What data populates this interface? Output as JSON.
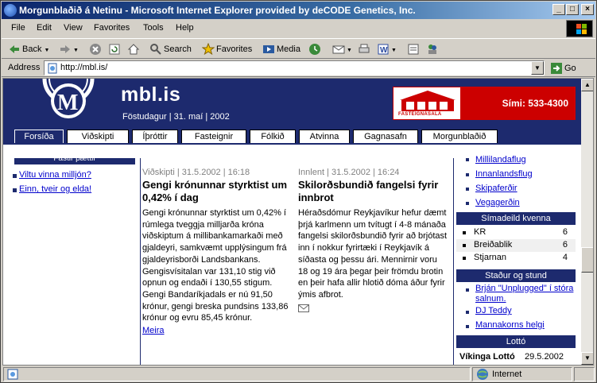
{
  "window": {
    "title": "Morgunblaðið á Netinu - Microsoft Internet Explorer provided by deCODE Genetics, Inc."
  },
  "menu": [
    "File",
    "Edit",
    "View",
    "Favorites",
    "Tools",
    "Help"
  ],
  "toolbar": {
    "back": "Back",
    "search": "Search",
    "favorites": "Favorites",
    "media": "Media"
  },
  "address": {
    "label": "Address",
    "url": "http://mbl.is/",
    "go": "Go"
  },
  "site": {
    "name": "mbl.is",
    "date": "Föstudagur | 31. maí | 2002",
    "ad_name": "FASTEIGNASALA",
    "ad_phone": "Sími: 533-4300",
    "colors": {
      "navy": "#1d2a6e",
      "ad_red": "#cc0000",
      "link": "#0000cc"
    }
  },
  "tabs": [
    "Forsíða",
    "Viðskipti",
    "Íþróttir",
    "Fasteignir",
    "Fólkið",
    "Atvinna",
    "Gagnasafn",
    "Morgunblaðið"
  ],
  "left": {
    "box_title": "Fastir þættir",
    "links": [
      "Viltu vinna milljón?",
      "Einn, tveir og elda!"
    ]
  },
  "news": [
    {
      "meta": "Viðskipti | 31.5.2002 | 16:18",
      "headline": "Gengi krónunnar styrktist um 0,42% í dag",
      "body": "Gengi krónunnar styrktist um 0,42% í rúmlega tveggja milljarða króna viðskiptum á millibankamarkaði með gjaldeyri, samkvæmt upplýsingum frá gjaldeyrisborði Landsbankans. Gengisvísitalan var 131,10 stig við opnun og endaði í 130,55 stigum. Gengi Bandaríkjadals er nú 91,50 krónur, gengi breska pundsins 133,86 krónur og evru 85,45 krónur.",
      "more": "Meira"
    },
    {
      "meta": "Innlent | 31.5.2002 | 16:24",
      "headline": "Skilorðsbundið fangelsi fyrir innbrot",
      "body": "Héraðsdómur Reykjavíkur hefur dæmt þrjá karlmenn um tvítugt í 4-8 mánaða fangelsi skilorðsbundið fyrir að brjótast inn í nokkur fyrirtæki í Reykjavík á síðasta og þessu ári. Mennirnir voru 18 og 19 ára þegar þeir frömdu brotin en þeir hafa allir hlotið dóma áður fyrir ýmis afbrot."
    }
  ],
  "right": {
    "links": [
      "Millilandaflug",
      "Innanlandsflug",
      "Skipaferðir",
      "Vegagerðin"
    ],
    "league": {
      "title": "Símadeild kvenna",
      "rows": [
        {
          "team": "KR",
          "pts": "6"
        },
        {
          "team": "Breiðablik",
          "pts": "6"
        },
        {
          "team": "Stjarnan",
          "pts": "4"
        }
      ]
    },
    "events": {
      "title": "Staður og stund",
      "links": [
        "Brján \"Unplugged\" í stóra salnum.",
        "DJ Teddy",
        "Mannakorns helgi"
      ]
    },
    "lotto": {
      "title": "Lottó",
      "name": "Víkinga Lottó",
      "date": "29.5.2002"
    }
  },
  "status": {
    "zone": "Internet"
  }
}
